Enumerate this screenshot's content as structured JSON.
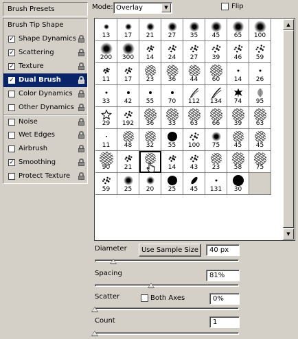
{
  "left_panel": {
    "presets_label": "Brush Presets",
    "tip_shape_label": "Brush Tip Shape",
    "items": [
      {
        "label": "Shape Dynamics",
        "checked": true,
        "locked": true
      },
      {
        "label": "Scattering",
        "checked": true,
        "locked": true
      },
      {
        "label": "Texture",
        "checked": true,
        "locked": true
      },
      {
        "label": "Dual Brush",
        "checked": true,
        "locked": true,
        "selected": true
      },
      {
        "label": "Color Dynamics",
        "checked": false,
        "locked": true
      },
      {
        "label": "Other Dynamics",
        "checked": false,
        "locked": true
      },
      {
        "label": "Noise",
        "checked": false,
        "locked": true
      },
      {
        "label": "Wet Edges",
        "checked": false,
        "locked": true
      },
      {
        "label": "Airbrush",
        "checked": false,
        "locked": true
      },
      {
        "label": "Smoothing",
        "checked": true,
        "locked": true
      },
      {
        "label": "Protect Texture",
        "checked": false,
        "locked": true
      }
    ]
  },
  "mode": {
    "label": "Mode:",
    "value": "Overlay"
  },
  "flip": {
    "label": "Flip",
    "checked": false
  },
  "brushes": [
    {
      "n": "13",
      "k": "soft",
      "s": 8
    },
    {
      "n": "17",
      "k": "soft",
      "s": 10
    },
    {
      "n": "21",
      "k": "soft",
      "s": 12
    },
    {
      "n": "27",
      "k": "soft",
      "s": 14
    },
    {
      "n": "35",
      "k": "soft",
      "s": 15
    },
    {
      "n": "45",
      "k": "soft",
      "s": 16
    },
    {
      "n": "65",
      "k": "soft",
      "s": 17
    },
    {
      "n": "100",
      "k": "soft",
      "s": 18
    },
    {
      "n": "200",
      "k": "soft",
      "s": 18
    },
    {
      "n": "300",
      "k": "soft",
      "s": 18
    },
    {
      "n": "14",
      "k": "spray",
      "s": 14
    },
    {
      "n": "24",
      "k": "spray",
      "s": 16
    },
    {
      "n": "27",
      "k": "spray",
      "s": 16
    },
    {
      "n": "39",
      "k": "spray",
      "s": 17
    },
    {
      "n": "46",
      "k": "spray",
      "s": 17
    },
    {
      "n": "59",
      "k": "spray",
      "s": 18
    },
    {
      "n": "11",
      "k": "spray",
      "s": 12
    },
    {
      "n": "17",
      "k": "spray",
      "s": 14
    },
    {
      "n": "23",
      "k": "texture",
      "s": 16
    },
    {
      "n": "36",
      "k": "texture",
      "s": 17
    },
    {
      "n": "44",
      "k": "texture",
      "s": 17
    },
    {
      "n": "60",
      "k": "texture",
      "s": 18
    },
    {
      "n": "14",
      "k": "dot",
      "s": 3
    },
    {
      "n": "26",
      "k": "dot",
      "s": 3
    },
    {
      "n": "33",
      "k": "dot",
      "s": 3
    },
    {
      "n": "42",
      "k": "dot",
      "s": 4
    },
    {
      "n": "55",
      "k": "dot",
      "s": 4
    },
    {
      "n": "70",
      "k": "dot",
      "s": 4
    },
    {
      "n": "112",
      "k": "grass",
      "s": 16
    },
    {
      "n": "134",
      "k": "grass",
      "s": 18
    },
    {
      "n": "74",
      "k": "leaf",
      "s": 16
    },
    {
      "n": "95",
      "k": "leaf2",
      "s": 16
    },
    {
      "n": "29",
      "k": "star",
      "s": 16
    },
    {
      "n": "192",
      "k": "spray",
      "s": 16
    },
    {
      "n": "36",
      "k": "texture",
      "s": 18
    },
    {
      "n": "33",
      "k": "texture",
      "s": 18
    },
    {
      "n": "63",
      "k": "texture",
      "s": 18
    },
    {
      "n": "66",
      "k": "texture",
      "s": 18
    },
    {
      "n": "39",
      "k": "texture",
      "s": 18
    },
    {
      "n": "63",
      "k": "texture",
      "s": 18
    },
    {
      "n": "11",
      "k": "dot",
      "s": 2
    },
    {
      "n": "48",
      "k": "texture",
      "s": 16
    },
    {
      "n": "32",
      "k": "texture",
      "s": 16
    },
    {
      "n": "55",
      "k": "hard",
      "s": 14
    },
    {
      "n": "100",
      "k": "spray",
      "s": 18
    },
    {
      "n": "75",
      "k": "soft",
      "s": 14
    },
    {
      "n": "45",
      "k": "texture",
      "s": 16
    },
    {
      "n": "45",
      "k": "texture",
      "s": 16
    },
    {
      "n": "90",
      "k": "texture",
      "s": 20
    },
    {
      "n": "21",
      "k": "spray",
      "s": 14
    },
    {
      "n": "",
      "k": "texture",
      "s": 16,
      "selected": true
    },
    {
      "n": "14",
      "k": "spray",
      "s": 14
    },
    {
      "n": "43",
      "k": "spray",
      "s": 16
    },
    {
      "n": "23",
      "k": "texture",
      "s": 16
    },
    {
      "n": "58",
      "k": "texture",
      "s": 18
    },
    {
      "n": "75",
      "k": "texture",
      "s": 18
    },
    {
      "n": "59",
      "k": "spray",
      "s": 16
    },
    {
      "n": "25",
      "k": "soft",
      "s": 14
    },
    {
      "n": "20",
      "k": "soft",
      "s": 12
    },
    {
      "n": "25",
      "k": "hard",
      "s": 14
    },
    {
      "n": "45",
      "k": "ellipse",
      "s": 14
    },
    {
      "n": "131",
      "k": "dot",
      "s": 3
    },
    {
      "n": "30",
      "k": "hard",
      "s": 16
    },
    {
      "n": "",
      "k": "empty",
      "s": 0
    }
  ],
  "diameter": {
    "label": "Diameter",
    "sample_button": "Use Sample Size",
    "value": "40 px",
    "slider_pct": 13
  },
  "spacing": {
    "label": "Spacing",
    "value": "81%",
    "slider_pct": 39
  },
  "scatter": {
    "label": "Scatter",
    "both_axes_label": "Both Axes",
    "both_axes_checked": false,
    "value": "0%",
    "slider_pct": 0
  },
  "count": {
    "label": "Count",
    "value": "1",
    "slider_pct": 0
  }
}
